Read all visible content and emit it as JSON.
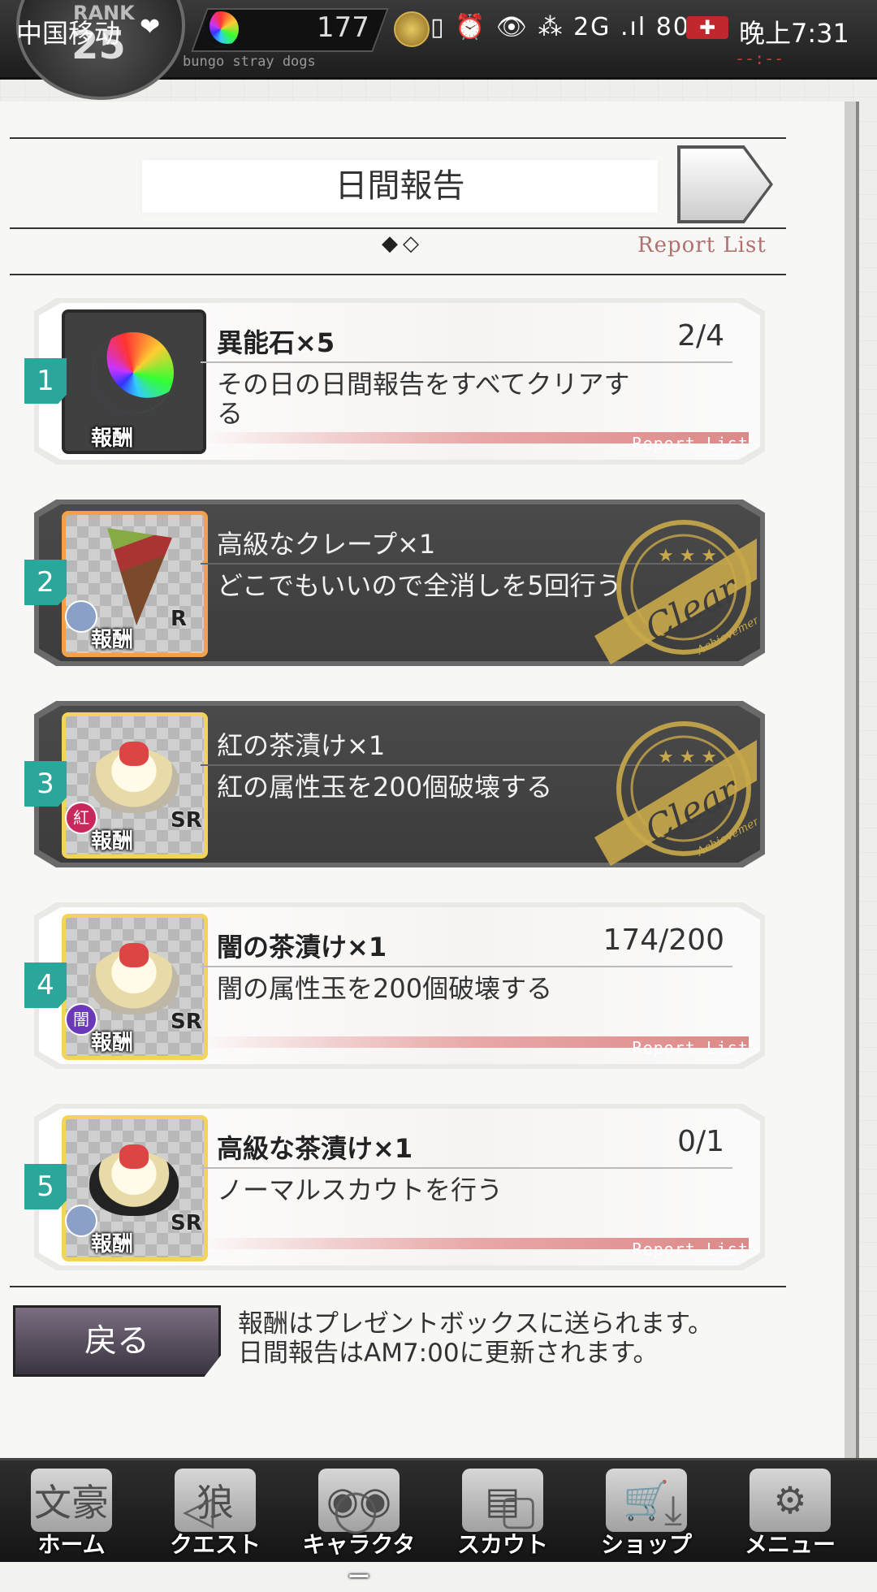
{
  "status_bar": {
    "carrier": "中国移动",
    "heart": "❤",
    "icons": "▯ ⏰ 👁 ⁂ 2G .ıl 80%",
    "battery": "✚",
    "time": "晚上7:31"
  },
  "header": {
    "rank_label": "RANK",
    "rank_value": "25",
    "game_subtitle": "bungo stray dogs",
    "gem_count": "177",
    "timer": "--:--"
  },
  "panel": {
    "title": "日間報告",
    "page_dots": "◆◇",
    "report_list_label": "Report List"
  },
  "cards": [
    {
      "number": "1",
      "reward": "異能石×5",
      "progress": "2/4",
      "description": "その日の日間報告をすべてクリアする",
      "reward_label": "報酬",
      "rarity": "",
      "report_list": "Report List",
      "cleared": false
    },
    {
      "number": "2",
      "reward": "高級なクレープ×1",
      "progress": "",
      "description": "どこでもいいので全消しを5回行う",
      "reward_label": "報酬",
      "rarity": "R",
      "report_list": "",
      "cleared": true
    },
    {
      "number": "3",
      "reward": "紅の茶漬け×1",
      "progress": "",
      "description": "紅の属性玉を200個破壊する",
      "reward_label": "報酬",
      "rarity": "SR",
      "attribute": "紅",
      "report_list": "",
      "cleared": true
    },
    {
      "number": "4",
      "reward": "闇の茶漬け×1",
      "progress": "174/200",
      "description": "闇の属性玉を200個破壊する",
      "reward_label": "報酬",
      "rarity": "SR",
      "attribute": "闇",
      "report_list": "Report List",
      "cleared": false
    },
    {
      "number": "5",
      "reward": "高級な茶漬け×1",
      "progress": "0/1",
      "description": "ノーマルスカウトを行う",
      "reward_label": "報酬",
      "rarity": "SR",
      "report_list": "Report List",
      "cleared": false
    }
  ],
  "stamp": {
    "text": "Clear",
    "subtext": "Achievement"
  },
  "footer": {
    "back_label": "戻る",
    "note_line1": "報酬はプレゼントボックスに送られます。",
    "note_line2": "日間報告はAM7:00に更新されます。"
  },
  "bottom_nav": [
    {
      "label": "ホーム",
      "icon": "文豪"
    },
    {
      "label": "クエスト",
      "icon": "狼"
    },
    {
      "label": "キャラクター",
      "icon": "◉◉"
    },
    {
      "label": "スカウト",
      "icon": "▤"
    },
    {
      "label": "ショップ",
      "icon": "🛒"
    },
    {
      "label": "メニュー",
      "icon": "⚙"
    }
  ],
  "android_nav": {
    "back": "◁",
    "home": "◯",
    "recents": "▢",
    "download": "⤓"
  },
  "colors": {
    "accent_teal": "#2aa69a",
    "report_pink": "#e8a8a8",
    "stamp_gold": "#c8a84a",
    "rarity_r_border": "#f2a04a",
    "rarity_sr_border": "#f2d45a"
  }
}
